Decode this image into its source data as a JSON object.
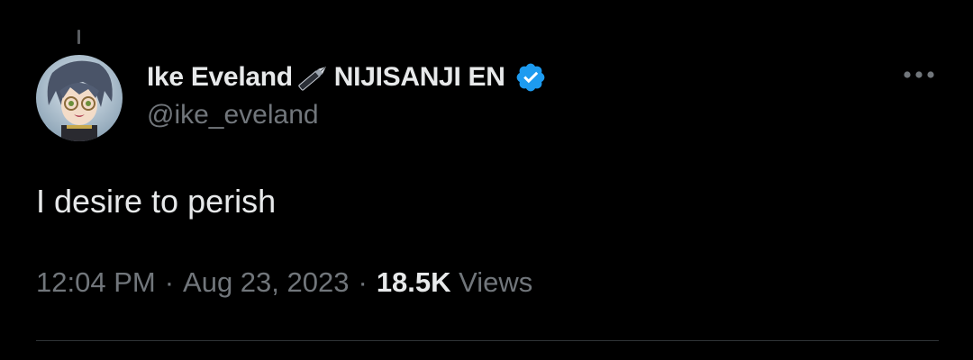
{
  "tweet": {
    "author": {
      "display_name": "Ike Eveland",
      "name_emoji": "pen-icon",
      "org_name": "NIJISANJI EN",
      "verified": true,
      "handle": "@ike_eveland",
      "avatar": "avatar-image"
    },
    "text": "I desire to perish",
    "time": "12:04 PM",
    "separator": "·",
    "date": "Aug 23, 2023",
    "views_count": "18.5K",
    "views_label": "Views",
    "more_icon": "more-horizontal-icon"
  },
  "colors": {
    "background": "#000000",
    "primary_text": "#e7e9ea",
    "secondary_text": "#71767b",
    "verified_badge": "#1d9bf0",
    "divider": "#2f3336"
  }
}
